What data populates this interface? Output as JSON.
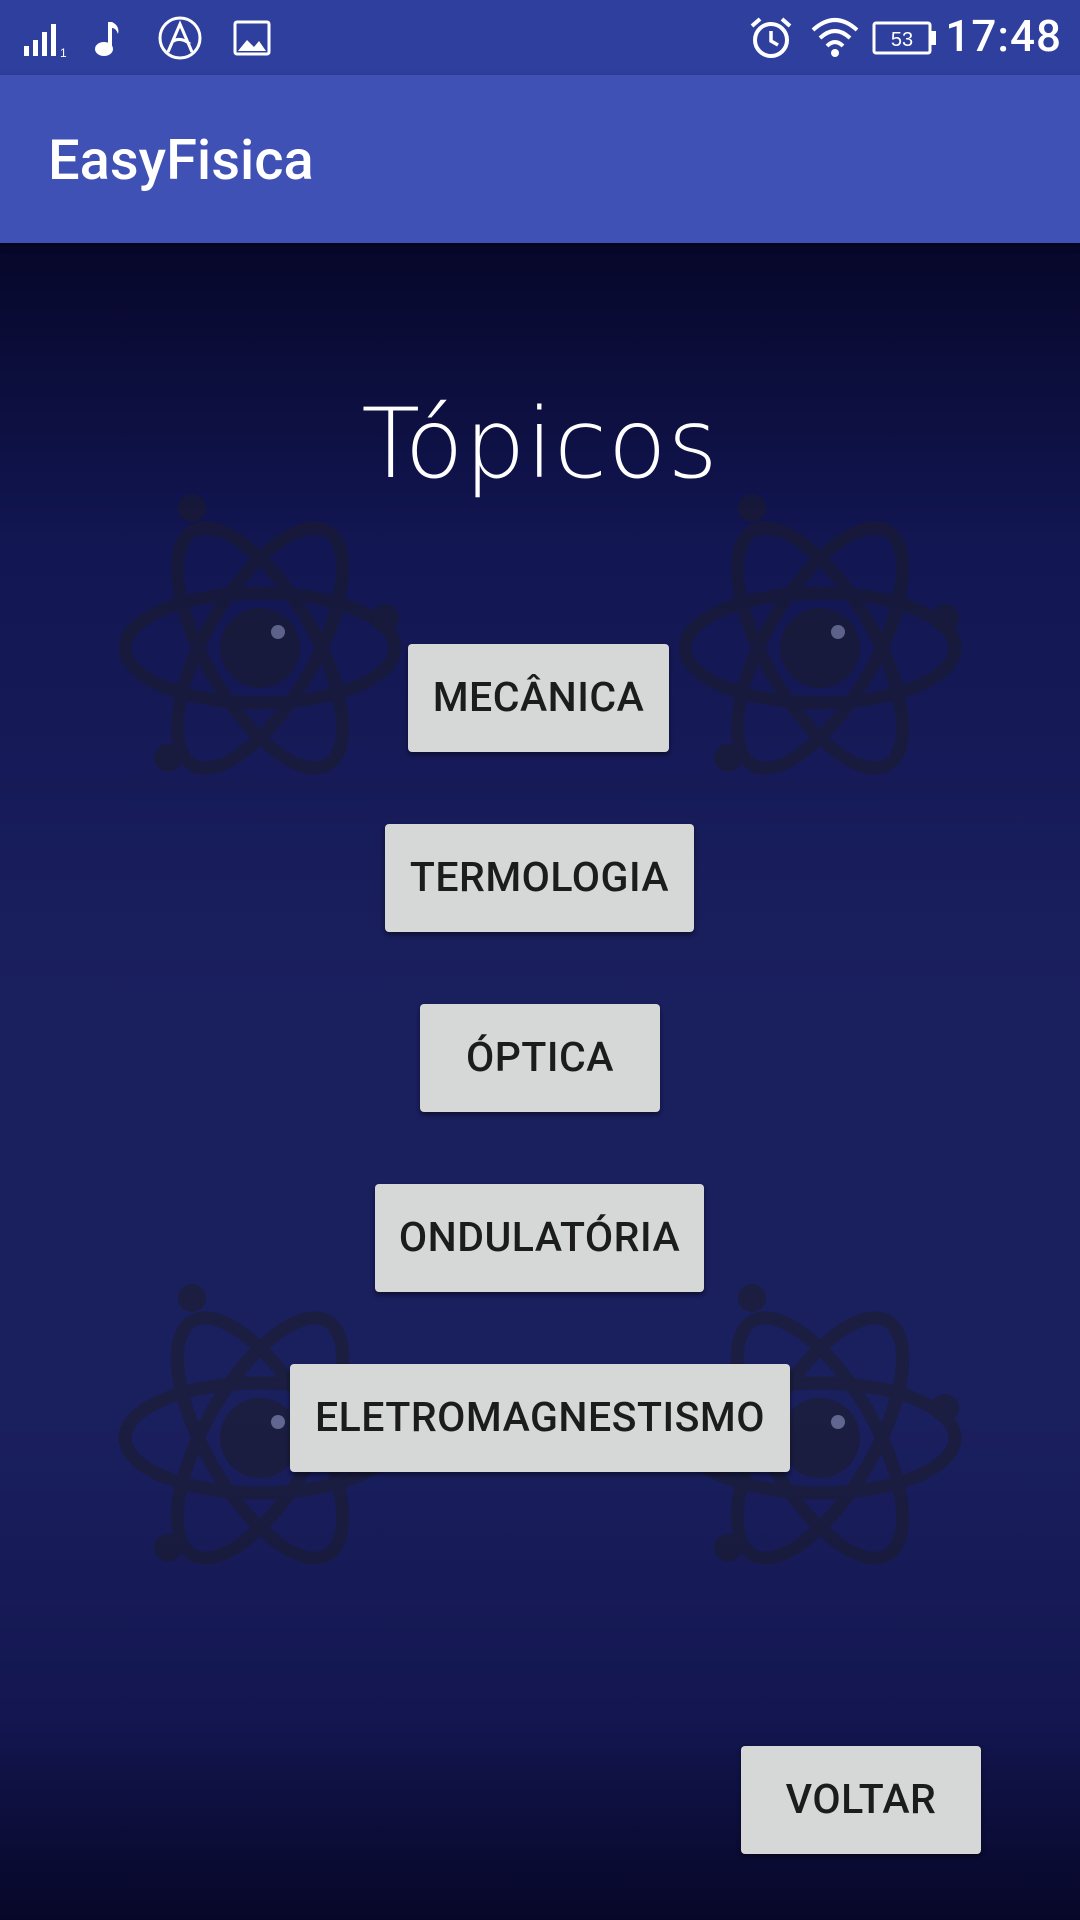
{
  "status_bar": {
    "time": "17:48",
    "battery": "53",
    "icons": [
      "signal-icon",
      "music-note-icon",
      "app-logo-icon",
      "image-icon",
      "alarm-icon",
      "wifi-icon",
      "battery-icon"
    ]
  },
  "app_bar": {
    "title": "EasyFisica"
  },
  "main": {
    "title": "Tópicos",
    "topics": [
      {
        "label": "MECÂNICA"
      },
      {
        "label": "TERMOLOGIA"
      },
      {
        "label": "ÓPTICA"
      },
      {
        "label": "ONDULATÓRIA"
      },
      {
        "label": "ELETROMAGNESTISMO"
      }
    ],
    "back_label": "VOLTAR"
  },
  "colors": {
    "status_bar": "#2f3f9e",
    "app_bar": "#3f51b5",
    "background_dark": "#07072a",
    "background_mid": "#1a1f5e",
    "button_bg": "#d6d7d7",
    "button_text": "#1c1c1c"
  }
}
